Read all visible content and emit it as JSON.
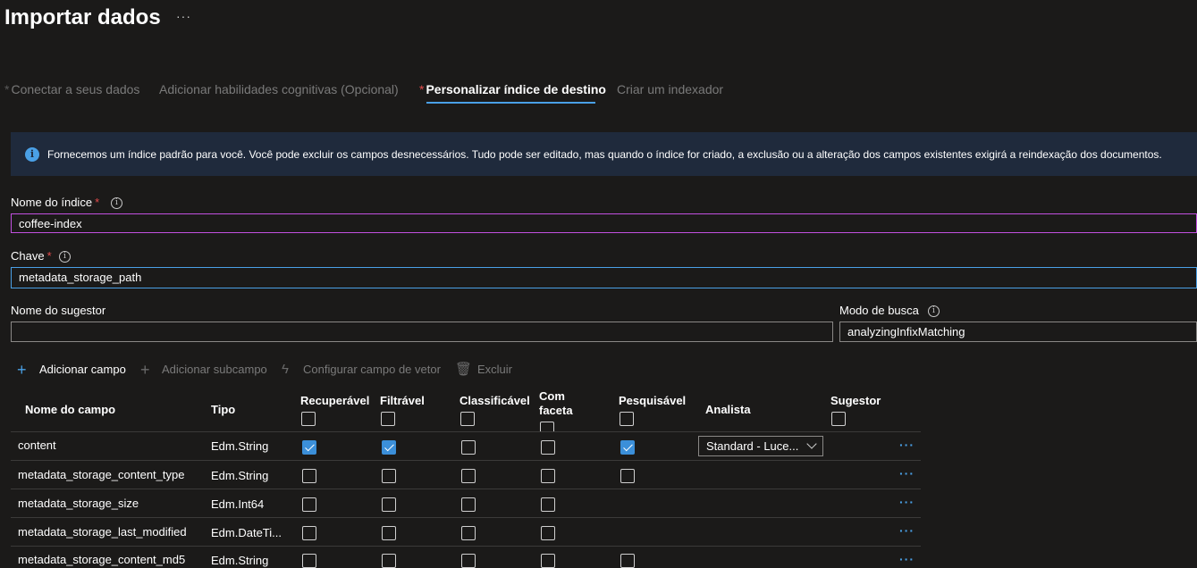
{
  "page": {
    "title": "Importar dados",
    "more": "···"
  },
  "steps": [
    {
      "label": "Conectar a seus dados",
      "required": "*"
    },
    {
      "label": "Adicionar habilidades cognitivas (Opcional)"
    },
    {
      "label": "Personalizar índice de destino",
      "required": "*",
      "active": true
    },
    {
      "label": "Criar um indexador"
    }
  ],
  "banner": {
    "icon": "info-icon",
    "text": "Fornecemos um índice padrão para você. Você pode excluir os campos desnecessários. Tudo pode ser editado, mas quando o índice for criado, a exclusão ou a alteração dos campos existentes exigirá a reindexação dos documentos."
  },
  "form": {
    "index_name_label": "Nome do índice",
    "index_name_value": "coffee-index",
    "key_label": "Chave",
    "key_value": "metadata_storage_path",
    "suggester_label": "Nome do sugestor",
    "suggester_value": "",
    "search_mode_label": "Modo de busca",
    "search_mode_value": "analyzingInfixMatching",
    "required_mark": "*",
    "info_glyph": "i"
  },
  "toolbar": {
    "add_field": "Adicionar campo",
    "add_subfield": "Adicionar subcampo",
    "configure_vector": "Configurar campo de vetor",
    "delete": "Excluir"
  },
  "table": {
    "headers": {
      "name": "Nome do campo",
      "type": "Tipo",
      "retrievable": "Recuperável",
      "filterable": "Filtrável",
      "sortable": "Classificável",
      "facetable": "Com faceta",
      "searchable": "Pesquisável",
      "analyzer": "Analista",
      "suggester": "Sugestor"
    },
    "rows": [
      {
        "name": "content",
        "type": "Edm.String",
        "retrievable": true,
        "filterable": true,
        "sortable": false,
        "facetable": false,
        "searchable": true,
        "analyzer": "Standard - Luce...",
        "more": "···"
      },
      {
        "name": "metadata_storage_content_type",
        "type": "Edm.String",
        "retrievable": false,
        "filterable": false,
        "sortable": false,
        "facetable": false,
        "searchable": false,
        "more": "···"
      },
      {
        "name": "metadata_storage_size",
        "type": "Edm.Int64",
        "retrievable": false,
        "filterable": false,
        "sortable": false,
        "facetable": false,
        "more": "···"
      },
      {
        "name": "metadata_storage_last_modified",
        "type": "Edm.DateTi...",
        "retrievable": false,
        "filterable": false,
        "sortable": false,
        "facetable": false,
        "more": "···"
      },
      {
        "name": "metadata_storage_content_md5",
        "type": "Edm.String",
        "retrievable": false,
        "filterable": false,
        "sortable": false,
        "facetable": false,
        "searchable": false,
        "more": "···"
      }
    ]
  },
  "colors": {
    "accent": "#4aa0e6",
    "checked": "#3b8fd9",
    "required": "#e34c4c",
    "background": "#1b1a19",
    "banner": "#1f2a3c"
  }
}
